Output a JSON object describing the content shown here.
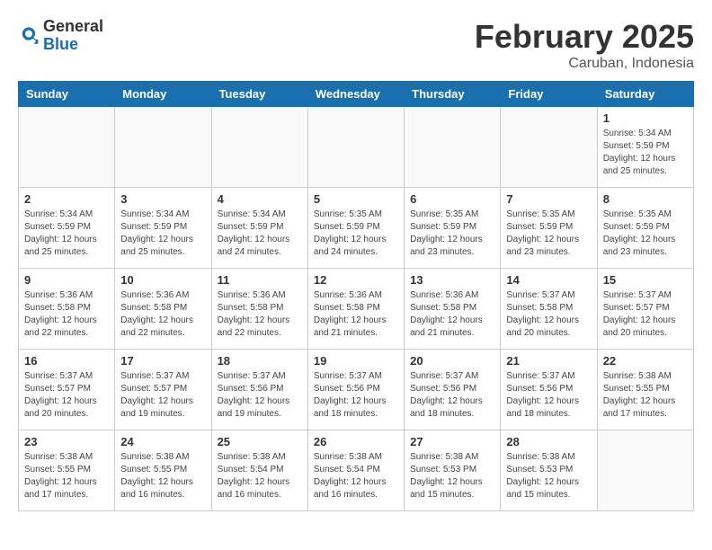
{
  "header": {
    "logo_general": "General",
    "logo_blue": "Blue",
    "month_title": "February 2025",
    "location": "Caruban, Indonesia"
  },
  "weekdays": [
    "Sunday",
    "Monday",
    "Tuesday",
    "Wednesday",
    "Thursday",
    "Friday",
    "Saturday"
  ],
  "weeks": [
    [
      {
        "day": "",
        "info": ""
      },
      {
        "day": "",
        "info": ""
      },
      {
        "day": "",
        "info": ""
      },
      {
        "day": "",
        "info": ""
      },
      {
        "day": "",
        "info": ""
      },
      {
        "day": "",
        "info": ""
      },
      {
        "day": "1",
        "info": "Sunrise: 5:34 AM\nSunset: 5:59 PM\nDaylight: 12 hours\nand 25 minutes."
      }
    ],
    [
      {
        "day": "2",
        "info": "Sunrise: 5:34 AM\nSunset: 5:59 PM\nDaylight: 12 hours\nand 25 minutes."
      },
      {
        "day": "3",
        "info": "Sunrise: 5:34 AM\nSunset: 5:59 PM\nDaylight: 12 hours\nand 25 minutes."
      },
      {
        "day": "4",
        "info": "Sunrise: 5:34 AM\nSunset: 5:59 PM\nDaylight: 12 hours\nand 24 minutes."
      },
      {
        "day": "5",
        "info": "Sunrise: 5:35 AM\nSunset: 5:59 PM\nDaylight: 12 hours\nand 24 minutes."
      },
      {
        "day": "6",
        "info": "Sunrise: 5:35 AM\nSunset: 5:59 PM\nDaylight: 12 hours\nand 23 minutes."
      },
      {
        "day": "7",
        "info": "Sunrise: 5:35 AM\nSunset: 5:59 PM\nDaylight: 12 hours\nand 23 minutes."
      },
      {
        "day": "8",
        "info": "Sunrise: 5:35 AM\nSunset: 5:59 PM\nDaylight: 12 hours\nand 23 minutes."
      }
    ],
    [
      {
        "day": "9",
        "info": "Sunrise: 5:36 AM\nSunset: 5:58 PM\nDaylight: 12 hours\nand 22 minutes."
      },
      {
        "day": "10",
        "info": "Sunrise: 5:36 AM\nSunset: 5:58 PM\nDaylight: 12 hours\nand 22 minutes."
      },
      {
        "day": "11",
        "info": "Sunrise: 5:36 AM\nSunset: 5:58 PM\nDaylight: 12 hours\nand 22 minutes."
      },
      {
        "day": "12",
        "info": "Sunrise: 5:36 AM\nSunset: 5:58 PM\nDaylight: 12 hours\nand 21 minutes."
      },
      {
        "day": "13",
        "info": "Sunrise: 5:36 AM\nSunset: 5:58 PM\nDaylight: 12 hours\nand 21 minutes."
      },
      {
        "day": "14",
        "info": "Sunrise: 5:37 AM\nSunset: 5:58 PM\nDaylight: 12 hours\nand 20 minutes."
      },
      {
        "day": "15",
        "info": "Sunrise: 5:37 AM\nSunset: 5:57 PM\nDaylight: 12 hours\nand 20 minutes."
      }
    ],
    [
      {
        "day": "16",
        "info": "Sunrise: 5:37 AM\nSunset: 5:57 PM\nDaylight: 12 hours\nand 20 minutes."
      },
      {
        "day": "17",
        "info": "Sunrise: 5:37 AM\nSunset: 5:57 PM\nDaylight: 12 hours\nand 19 minutes."
      },
      {
        "day": "18",
        "info": "Sunrise: 5:37 AM\nSunset: 5:56 PM\nDaylight: 12 hours\nand 19 minutes."
      },
      {
        "day": "19",
        "info": "Sunrise: 5:37 AM\nSunset: 5:56 PM\nDaylight: 12 hours\nand 18 minutes."
      },
      {
        "day": "20",
        "info": "Sunrise: 5:37 AM\nSunset: 5:56 PM\nDaylight: 12 hours\nand 18 minutes."
      },
      {
        "day": "21",
        "info": "Sunrise: 5:37 AM\nSunset: 5:56 PM\nDaylight: 12 hours\nand 18 minutes."
      },
      {
        "day": "22",
        "info": "Sunrise: 5:38 AM\nSunset: 5:55 PM\nDaylight: 12 hours\nand 17 minutes."
      }
    ],
    [
      {
        "day": "23",
        "info": "Sunrise: 5:38 AM\nSunset: 5:55 PM\nDaylight: 12 hours\nand 17 minutes."
      },
      {
        "day": "24",
        "info": "Sunrise: 5:38 AM\nSunset: 5:55 PM\nDaylight: 12 hours\nand 16 minutes."
      },
      {
        "day": "25",
        "info": "Sunrise: 5:38 AM\nSunset: 5:54 PM\nDaylight: 12 hours\nand 16 minutes."
      },
      {
        "day": "26",
        "info": "Sunrise: 5:38 AM\nSunset: 5:54 PM\nDaylight: 12 hours\nand 16 minutes."
      },
      {
        "day": "27",
        "info": "Sunrise: 5:38 AM\nSunset: 5:53 PM\nDaylight: 12 hours\nand 15 minutes."
      },
      {
        "day": "28",
        "info": "Sunrise: 5:38 AM\nSunset: 5:53 PM\nDaylight: 12 hours\nand 15 minutes."
      },
      {
        "day": "",
        "info": ""
      }
    ]
  ]
}
